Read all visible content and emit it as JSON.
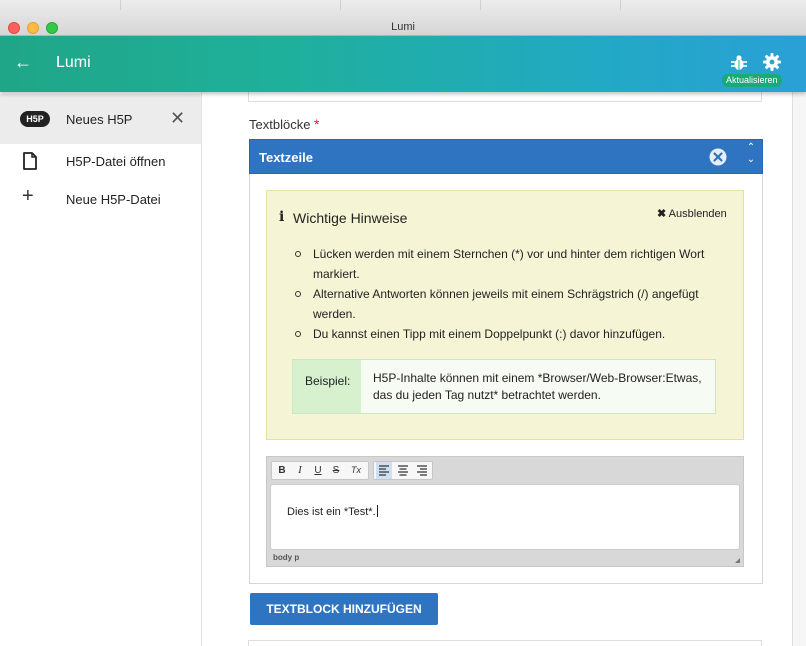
{
  "window": {
    "title": "Lumi"
  },
  "header": {
    "back_icon": "arrow-left-icon",
    "title": "Lumi",
    "update_tooltip": "Aktualisieren"
  },
  "sidebar": {
    "items": [
      {
        "label": "Neues H5P",
        "badge": "H5P",
        "active": true
      },
      {
        "label": "H5P-Datei öffnen",
        "icon": "file-icon"
      },
      {
        "label": "Neue H5P-Datei",
        "icon": "plus-icon"
      }
    ]
  },
  "editor": {
    "field_label": "Textblöcke",
    "required_mark": "*",
    "group_title": "Textzeile",
    "notes": {
      "title": "Wichtige Hinweise",
      "hide_label": "Ausblenden",
      "items": [
        "Lücken werden mit einem Sternchen (*) vor und hinter dem richtigen Wort markiert.",
        "Alternative Antworten können jeweils mit einem Schrägstrich (/) angefügt werden.",
        "Du kannst einen Tipp mit einem Doppelpunkt (:) davor hinzufügen."
      ],
      "example_label": "Beispiel:",
      "example_text": "H5P-Inhalte können mit einem *Browser/Web-Browser:Etwas, das du jeden Tag nutzt* betrachtet werden."
    },
    "toolbar": {
      "bold": "B",
      "italic": "I",
      "underline": "U",
      "strike": "S",
      "clear": "Tx"
    },
    "text_value": "Dies ist ein *Test*.",
    "path": "body  p",
    "add_button": "TEXTBLOCK HINZUFÜGEN"
  },
  "colors": {
    "accent": "#2f74c0",
    "header_start": "#1fa687",
    "header_end": "#2aa0d6",
    "notes_bg": "#f5f5d6",
    "required": "#e0182d"
  }
}
